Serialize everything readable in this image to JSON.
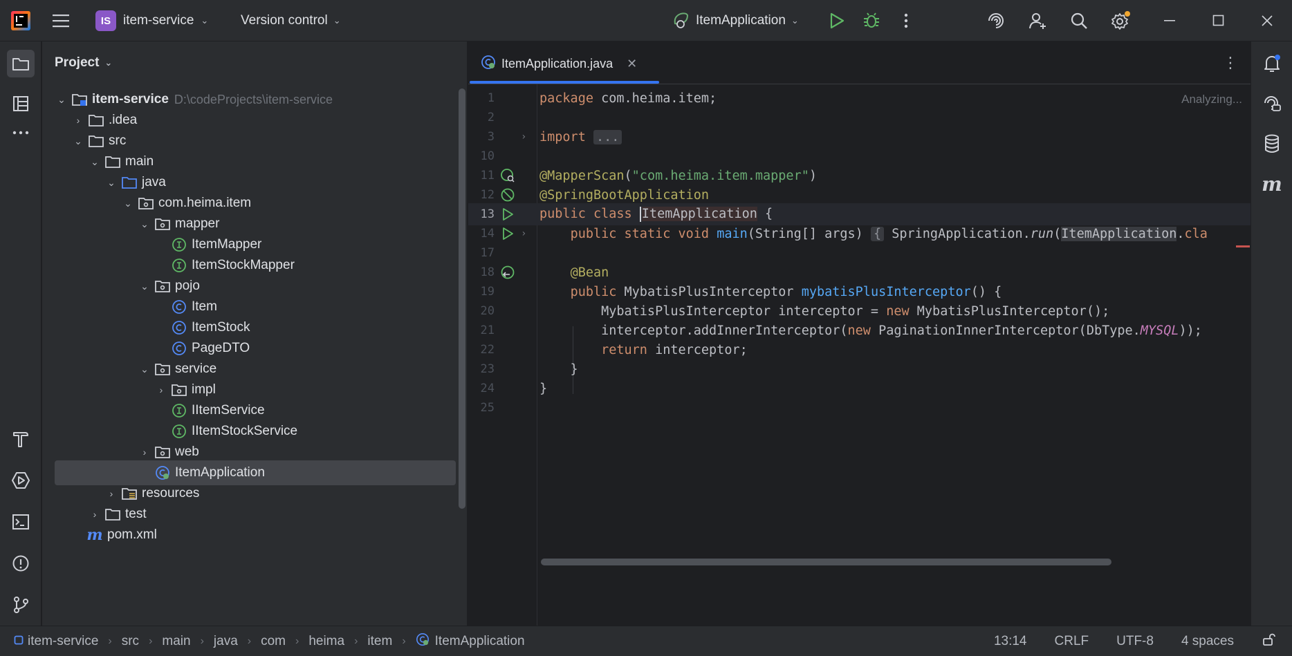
{
  "titlebar": {
    "project_badge": "IS",
    "project_name": "item-service",
    "version_control": "Version control",
    "run_config": "ItemApplication"
  },
  "project_panel": {
    "title": "Project",
    "tree": [
      {
        "label": "item-service",
        "path": "D:\\codeProjects\\item-service"
      },
      {
        "label": ".idea"
      },
      {
        "label": "src"
      },
      {
        "label": "main"
      },
      {
        "label": "java"
      },
      {
        "label": "com.heima.item"
      },
      {
        "label": "mapper"
      },
      {
        "label": "ItemMapper"
      },
      {
        "label": "ItemStockMapper"
      },
      {
        "label": "pojo"
      },
      {
        "label": "Item"
      },
      {
        "label": "ItemStock"
      },
      {
        "label": "PageDTO"
      },
      {
        "label": "service"
      },
      {
        "label": "impl"
      },
      {
        "label": "IItemService"
      },
      {
        "label": "IItemStockService"
      },
      {
        "label": "web"
      },
      {
        "label": "ItemApplication"
      },
      {
        "label": "resources"
      },
      {
        "label": "test"
      },
      {
        "label": "pom.xml"
      }
    ]
  },
  "editor": {
    "tab_label": "ItemApplication.java",
    "status": "Analyzing...",
    "line_numbers": [
      "1",
      "2",
      "3",
      "10",
      "11",
      "12",
      "13",
      "14",
      "17",
      "18",
      "19",
      "20",
      "21",
      "22",
      "23",
      "24",
      "25"
    ]
  },
  "statusbar": {
    "crumbs": [
      "item-service",
      "src",
      "main",
      "java",
      "com",
      "heima",
      "item",
      "ItemApplication"
    ],
    "position": "13:14",
    "line_sep": "CRLF",
    "encoding": "UTF-8",
    "indent": "4 spaces"
  }
}
